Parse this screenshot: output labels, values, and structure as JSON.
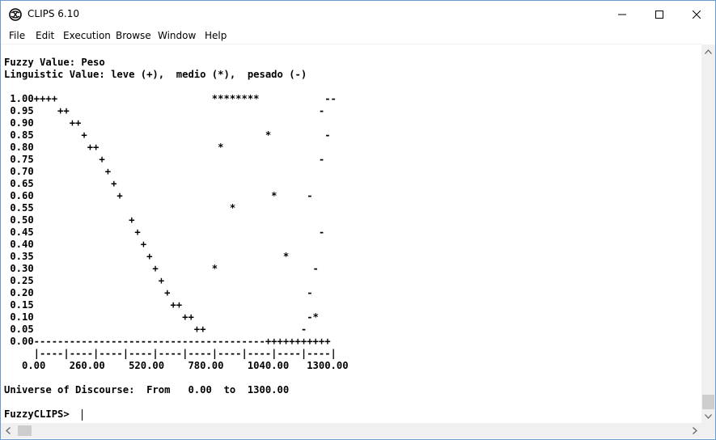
{
  "window": {
    "title": "CLIPS 6.10",
    "controls": {
      "minimize": "minimize-icon",
      "maximize": "maximize-icon",
      "close": "close-icon"
    }
  },
  "menu": [
    "File",
    "Edit",
    "Execution",
    "Browse",
    "Window",
    "Help"
  ],
  "output": {
    "header": [
      "Fuzzy Value: Peso",
      "Linguistic Value: leve (+),  medio (*),  pesado (-)"
    ],
    "plot_rows": [
      " 1.00++++                          ********           --",
      " 0.95    ++                                          -",
      " 0.90      ++",
      " 0.85        +                              *         -",
      " 0.80         ++                    *",
      " 0.75           +                                    -",
      " 0.70            +",
      " 0.65             +",
      " 0.60              +                         *     -",
      " 0.55                                 *",
      " 0.50                +",
      " 0.45                 +                              -",
      " 0.40                  +",
      " 0.35                   +                      *",
      " 0.30                    +         *                -",
      " 0.25                     +",
      " 0.20                      +                       -",
      " 0.15                       ++",
      " 0.10                         ++                   -*",
      " 0.05                           ++                -",
      " 0.00---------------------------------------+++++++++++",
      "     |----|----|----|----|----|----|----|----|----|----|",
      "   0.00    260.00    520.00    780.00    1040.00   1300.00"
    ],
    "universe": "Universe of Discourse:  From   0.00  to  1300.00",
    "prompt": "FuzzyCLIPS> "
  },
  "scrollbars": {
    "vertical": {
      "up": "scroll-up-arrow-icon",
      "down": "scroll-down-arrow-icon",
      "position": 0.97
    },
    "horizontal": {
      "left": "scroll-left-arrow-icon",
      "right": "scroll-right-arrow-icon",
      "position": 0.0
    }
  },
  "colors": {
    "window_border": "#6b9bd1",
    "scroll_track": "#f0f0f0",
    "scroll_thumb": "#cdcdcd",
    "text": "#000000"
  }
}
